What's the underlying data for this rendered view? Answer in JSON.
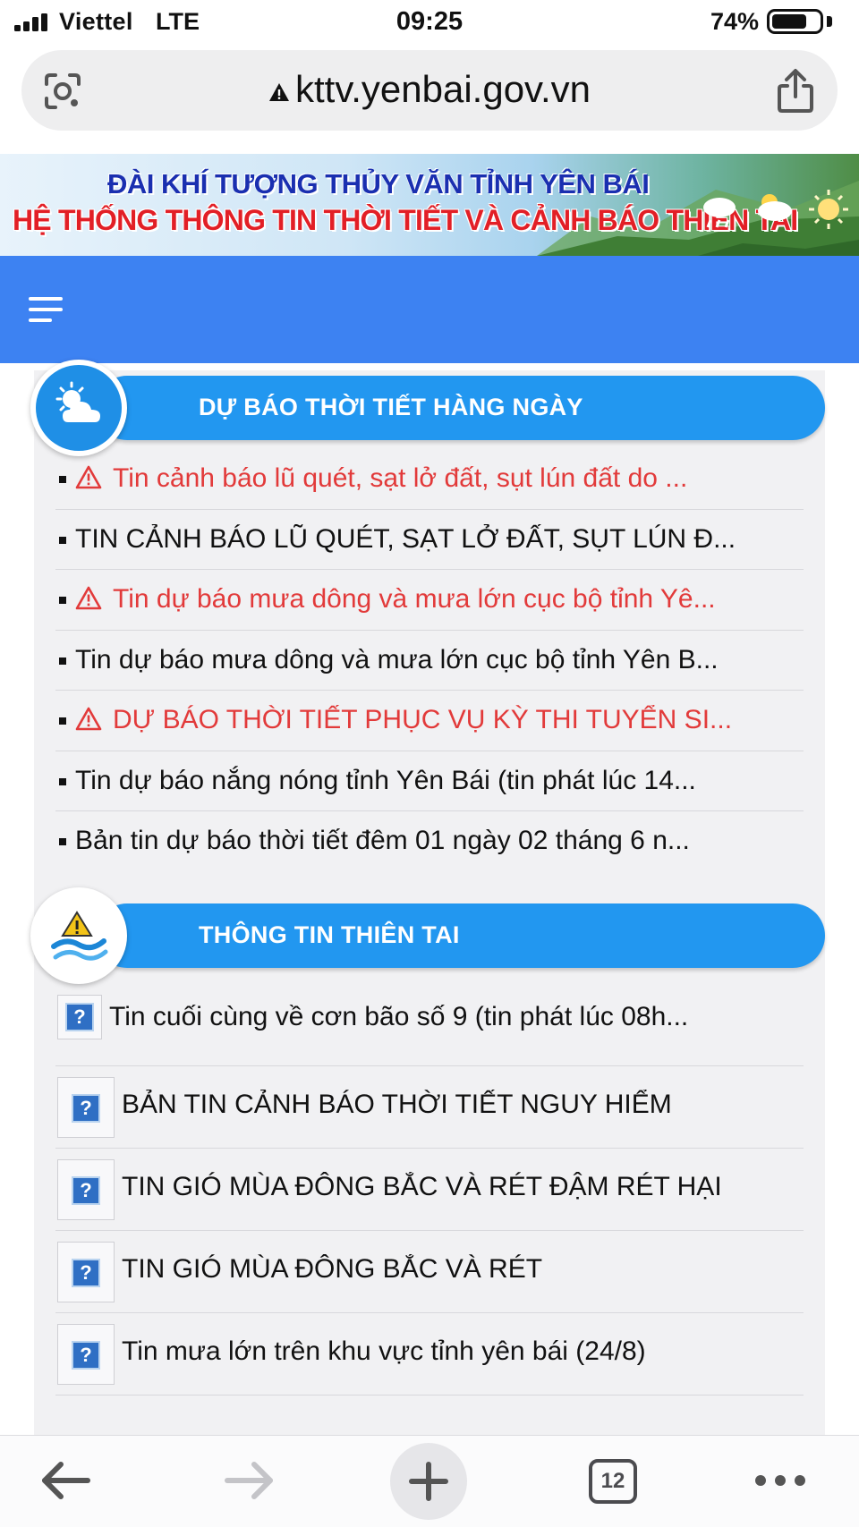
{
  "status_bar": {
    "carrier": "Viettel",
    "network": "LTE",
    "time": "09:25",
    "battery_percent": "74%",
    "battery_level": 0.74
  },
  "browser": {
    "url": "kttv.yenbai.gov.vn",
    "lens_icon": "google-lens-icon",
    "share_icon": "share-icon",
    "warning_icon": "not-secure-warning-icon"
  },
  "banner": {
    "line1": "ĐÀI KHÍ TƯỢNG THỦY VĂN TỈNH YÊN BÁI",
    "line2": "HỆ THỐNG THÔNG TIN THỜI TIẾT VÀ CẢNH BÁO THIÊN TAI",
    "line1_color": "#1a2fb0",
    "line2_color": "#e21f26"
  },
  "navbar": {
    "color": "#3d82f2",
    "menu_icon": "hamburger-menu-icon"
  },
  "forecast_section": {
    "title": "DỰ BÁO THỜI TIẾT HÀNG NGÀY",
    "icon": "sun-cloud-icon",
    "items": [
      {
        "text": "Tin cảnh báo lũ quét, sạt lở đất, sụt lún đất do ...",
        "alert": true
      },
      {
        "text": "TIN CẢNH BÁO LŨ QUÉT, SẠT LỞ ĐẤT, SỤT LÚN Đ...",
        "alert": false
      },
      {
        "text": "Tin dự báo mưa dông và mưa lớn cục bộ tỉnh Yê...",
        "alert": true
      },
      {
        "text": "Tin dự báo mưa dông và mưa lớn cục bộ tỉnh Yên B...",
        "alert": false
      },
      {
        "text": "DỰ BÁO THỜI TIẾT PHỤC VỤ KỲ THI TUYỂN SI...",
        "alert": true
      },
      {
        "text": "Tin dự báo nắng nóng tỉnh Yên Bái (tin phát lúc 14...",
        "alert": false
      },
      {
        "text": "Bản tin dự báo thời tiết đêm 01 ngày 02 tháng 6 n...",
        "alert": false
      }
    ]
  },
  "disaster_section": {
    "title": "THÔNG TIN THIÊN TAI",
    "icon": "warning-wave-icon",
    "items": [
      {
        "text": "Tin cuối cùng về cơn bão số 9 (tin phát lúc 08h..."
      },
      {
        "text": "BẢN TIN CẢNH BÁO THỜI TIẾT NGUY HIỂM"
      },
      {
        "text": "TIN GIÓ MÙA ĐÔNG BẮC VÀ RÉT ĐẬM RÉT HẠI"
      },
      {
        "text": "TIN GIÓ MÙA ĐÔNG BẮC VÀ RÉT"
      },
      {
        "text": "Tin mưa lớn trên khu vực tỉnh yên bái (24/8)"
      }
    ]
  },
  "toolbar": {
    "tab_count": "12",
    "back_icon": "back-arrow-icon",
    "forward_icon": "forward-arrow-icon",
    "new_tab_icon": "plus-icon",
    "more_icon": "more-dots-icon"
  },
  "colors": {
    "section_blue": "#2297f0",
    "alert_red": "#e23a3a",
    "content_bg": "#f1f1f3"
  }
}
